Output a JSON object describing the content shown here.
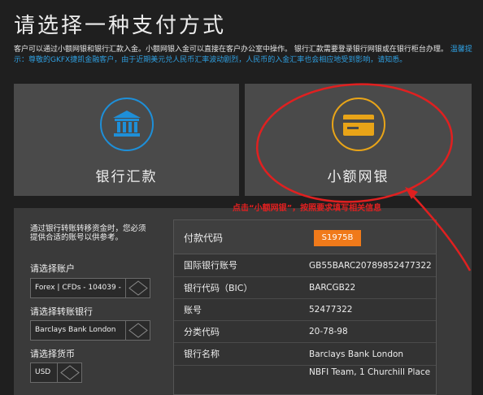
{
  "page": {
    "title": "请选择一种支付方式",
    "info": {
      "text": "客户可以通过小额网银和银行汇款入金。小额网银入金可以直接在客户办公室中操作。 银行汇款需要登录银行网银或在银行柜台办理。",
      "highlight": "温馨提示：尊敬的GKFX捷凯金融客户，由于近期美元兑人民币汇率波动剧烈，人民币的入金汇率也会相应地受到影响，请知悉。"
    }
  },
  "methods": [
    {
      "label": "银行汇款",
      "icon": "bank-icon",
      "accent": "#1e8fd8"
    },
    {
      "label": "小额网银",
      "icon": "card-icon",
      "accent": "#e8a418"
    }
  ],
  "annotation": {
    "text": "点击“小额网银”，按照要求填写相关信息",
    "color": "#e02020"
  },
  "form": {
    "intro": "通过银行转账转移资金时，您必须提供合适的账号以供参考。",
    "account_label": "请选择账户",
    "account_value": "Forex | CFDs - 104039 -",
    "bank_label": "请选择转账银行",
    "bank_value": "Barclays Bank London",
    "currency_label": "请选择货币",
    "currency_value": "USD"
  },
  "details": {
    "code_label": "付款代码",
    "code_value": "S1975B",
    "rows": [
      {
        "k": "国际银行账号",
        "v": "GB55BARC20789852477322"
      },
      {
        "k": "银行代码（BIC）",
        "v": "BARCGB22"
      },
      {
        "k": "账号",
        "v": "52477322"
      },
      {
        "k": "分类代码",
        "v": "20-78-98"
      },
      {
        "k": "银行名称",
        "v": "Barclays Bank London"
      },
      {
        "k": "",
        "v": "NBFI Team, 1 Churchill Place"
      }
    ]
  },
  "colors": {
    "badge": "#f07a1a",
    "highlight": "#2f9fe0"
  }
}
